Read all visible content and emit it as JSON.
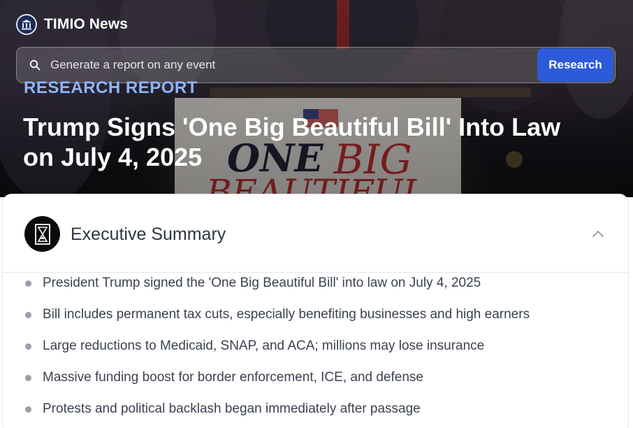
{
  "header": {
    "brand_name": "TIMIO News",
    "logo_icon": "timio-logo-icon"
  },
  "search": {
    "placeholder": "Generate a report on any event",
    "button_label": "Research"
  },
  "report": {
    "eyebrow": "RESEARCH REPORT",
    "title": "Trump Signs 'One Big Beautiful Bill' Into Law on July 4, 2025"
  },
  "summary": {
    "title": "Executive Summary",
    "icon": "hourglass-icon",
    "collapse_icon": "chevron-up-icon",
    "items": [
      "President Trump signed the 'One Big Beautiful Bill' into law on July 4, 2025",
      "Bill includes permanent tax cuts, especially benefiting businesses and high earners",
      "Large reductions to Medicaid, SNAP, and ACA; millions may lose insurance",
      "Massive funding boost for border enforcement, ICE, and defense",
      "Protests and political backlash began immediately after passage"
    ]
  },
  "colors": {
    "accent": "#2d5ad8",
    "eyebrow": "#8fb4ff",
    "summary_icon_bg": "#0a0a0a"
  }
}
